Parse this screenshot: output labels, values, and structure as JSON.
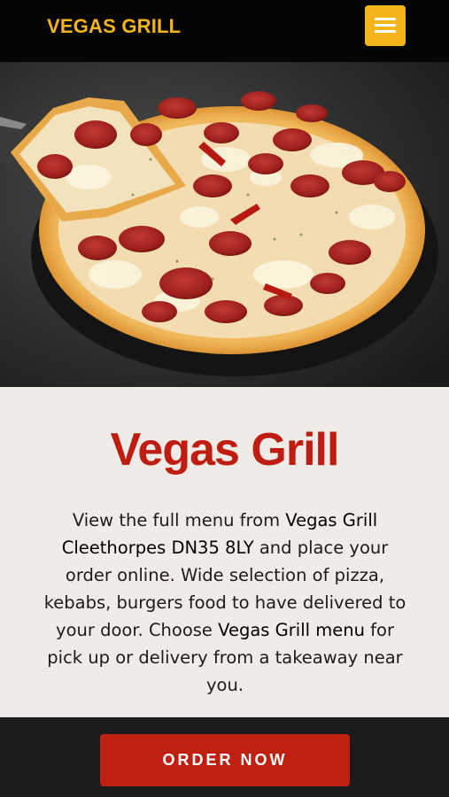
{
  "header": {
    "brand": "VEGAS GRILL",
    "menu_icon": "hamburger-menu-icon",
    "brand_color": "#f3b51b",
    "background": "#050505"
  },
  "hero": {
    "image_subject": "pepperoni pizza with a slice being lifted by a server",
    "background": "#333333"
  },
  "main": {
    "title": "Vegas Grill",
    "title_color": "#bf1c12",
    "description": {
      "p1": "View the full menu from ",
      "h1": "Vegas Grill Cleethorpes DN35 8LY",
      "p2": " and place your order online. Wide selection of pizza, kebabs, burgers food to have delivered to your door. Choose ",
      "h2": "Vegas Grill menu",
      "p3": " for pick up or delivery from a takeaway near you."
    }
  },
  "footer": {
    "order_button": "ORDER NOW",
    "button_color": "#c0200f",
    "background": "#1c1c1c"
  }
}
